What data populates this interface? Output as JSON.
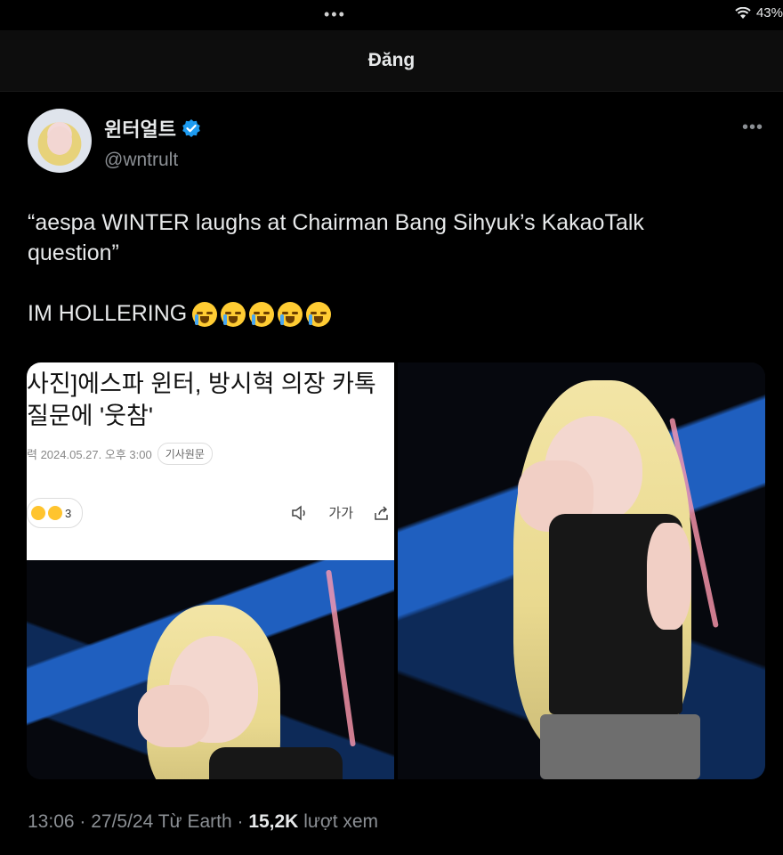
{
  "status_bar": {
    "dots": "•••",
    "battery": "43%"
  },
  "header": {
    "title": "Đăng"
  },
  "tweet": {
    "display_name": "윈터얼트",
    "handle": "@wntrult",
    "more": "•••",
    "text_line1": "“aespa WINTER laughs at Chairman Bang Sihyuk’s KakaoTalk question”",
    "text_line2": "IM HOLLERING",
    "emoji_count": 5
  },
  "media": {
    "article": {
      "title": "사진]에스파 윈터, 방시혁 의장 카톡\n질문에 '웃참'",
      "date": "력 2024.05.27. 오후 3:00",
      "badge": "기사원문",
      "reaction_count": "3",
      "font_tool": "가가"
    }
  },
  "footer": {
    "time_date": "13:06 · 27/5/24 Từ Earth · ",
    "views": "15,2K",
    "views_label": " lượt xem"
  },
  "colors": {
    "background": "#000000",
    "text": "#e7e9ea",
    "muted": "#8b8f94",
    "verified": "#1d9bf0"
  }
}
